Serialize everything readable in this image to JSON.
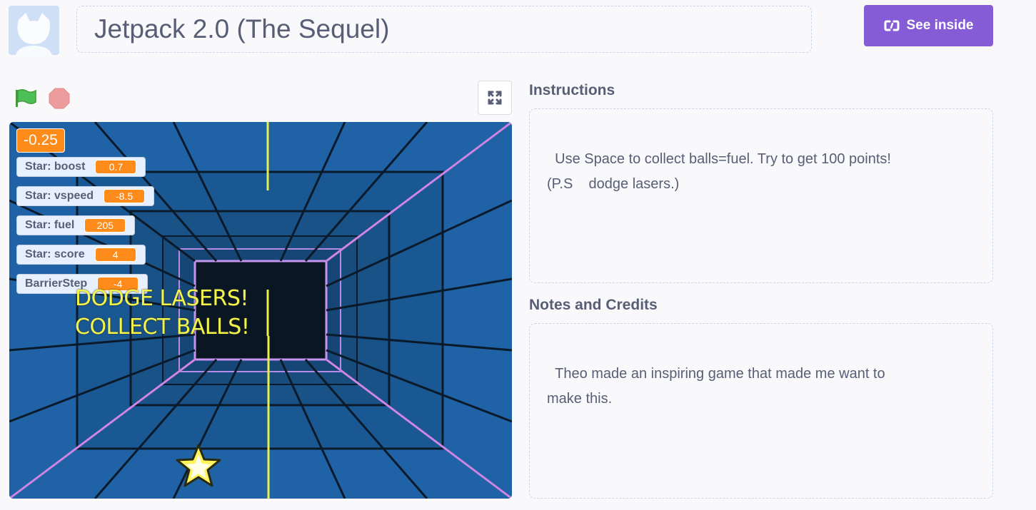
{
  "project": {
    "title": "Jetpack 2.0 (The Sequel)",
    "see_inside_label": "See inside"
  },
  "stage": {
    "big_monitor_value": "-0.25",
    "monitors": [
      {
        "label": "Star: boost",
        "value": "0.7"
      },
      {
        "label": "Star: vspeed",
        "value": "-8.5"
      },
      {
        "label": "Star: fuel",
        "value": "205"
      },
      {
        "label": "Star: score",
        "value": "4"
      },
      {
        "label": "BarrierStep",
        "value": "-4"
      }
    ],
    "text_line1": "DODGE LASERS!",
    "text_line2": "COLLECT BALLS!"
  },
  "instructions": {
    "heading": "Instructions",
    "body": "Use Space to collect balls=fuel. Try to get 100 points!\n(P.S    dodge lasers.)"
  },
  "notes": {
    "heading": "Notes and Credits",
    "body": "Theo made an inspiring game that made me want to\nmake this."
  },
  "colors": {
    "accent": "#855cd6",
    "monitor_orange": "#ff8c1a",
    "green_flag": "#4cbf56",
    "stop": "#ec9c9c"
  },
  "icons": [
    "user-avatar-icon",
    "see-inside-icon",
    "green-flag-icon",
    "stop-icon",
    "fullscreen-icon",
    "star-sprite-icon"
  ]
}
